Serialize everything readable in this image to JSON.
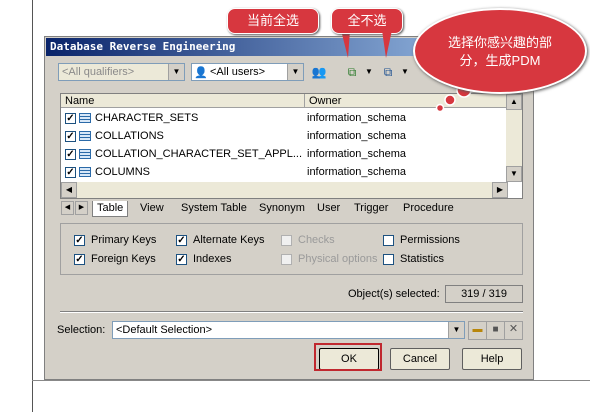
{
  "dialog": {
    "title": "Database Reverse Engineering",
    "qualifiers": "<All qualifiers>",
    "users": "<All users>",
    "columns": [
      "Name",
      "Owner"
    ],
    "rows": [
      {
        "name": "CHARACTER_SETS",
        "owner": "information_schema",
        "checked": true
      },
      {
        "name": "COLLATIONS",
        "owner": "information_schema",
        "checked": true
      },
      {
        "name": "COLLATION_CHARACTER_SET_APPL...",
        "owner": "information_schema",
        "checked": true
      },
      {
        "name": "COLUMNS",
        "owner": "information_schema",
        "checked": true
      }
    ],
    "tabs": [
      "Table",
      "View",
      "System Table",
      "Synonym",
      "User",
      "Trigger",
      "Procedure"
    ],
    "options": {
      "primary_keys": "Primary Keys",
      "alternate_keys": "Alternate Keys",
      "checks": "Checks",
      "permissions": "Permissions",
      "foreign_keys": "Foreign Keys",
      "indexes": "Indexes",
      "physical_options": "Physical options",
      "statistics": "Statistics"
    },
    "objects_selected_label": "Object(s) selected:",
    "objects_selected_value": "319 / 319",
    "selection_label": "Selection:",
    "selection_value": "<Default Selection>",
    "ok": "OK",
    "cancel": "Cancel",
    "help": "Help"
  },
  "annotations": {
    "select_all": "当前全选",
    "select_none": "全不选",
    "note_line1": "选择你感兴趣的部",
    "note_line2": "分，生成PDM"
  },
  "colors": {
    "callout": "#d7373f",
    "titlebar_start": "#0a246a",
    "titlebar_end": "#a6caf0",
    "dialog_bg": "#d4d0c8"
  }
}
